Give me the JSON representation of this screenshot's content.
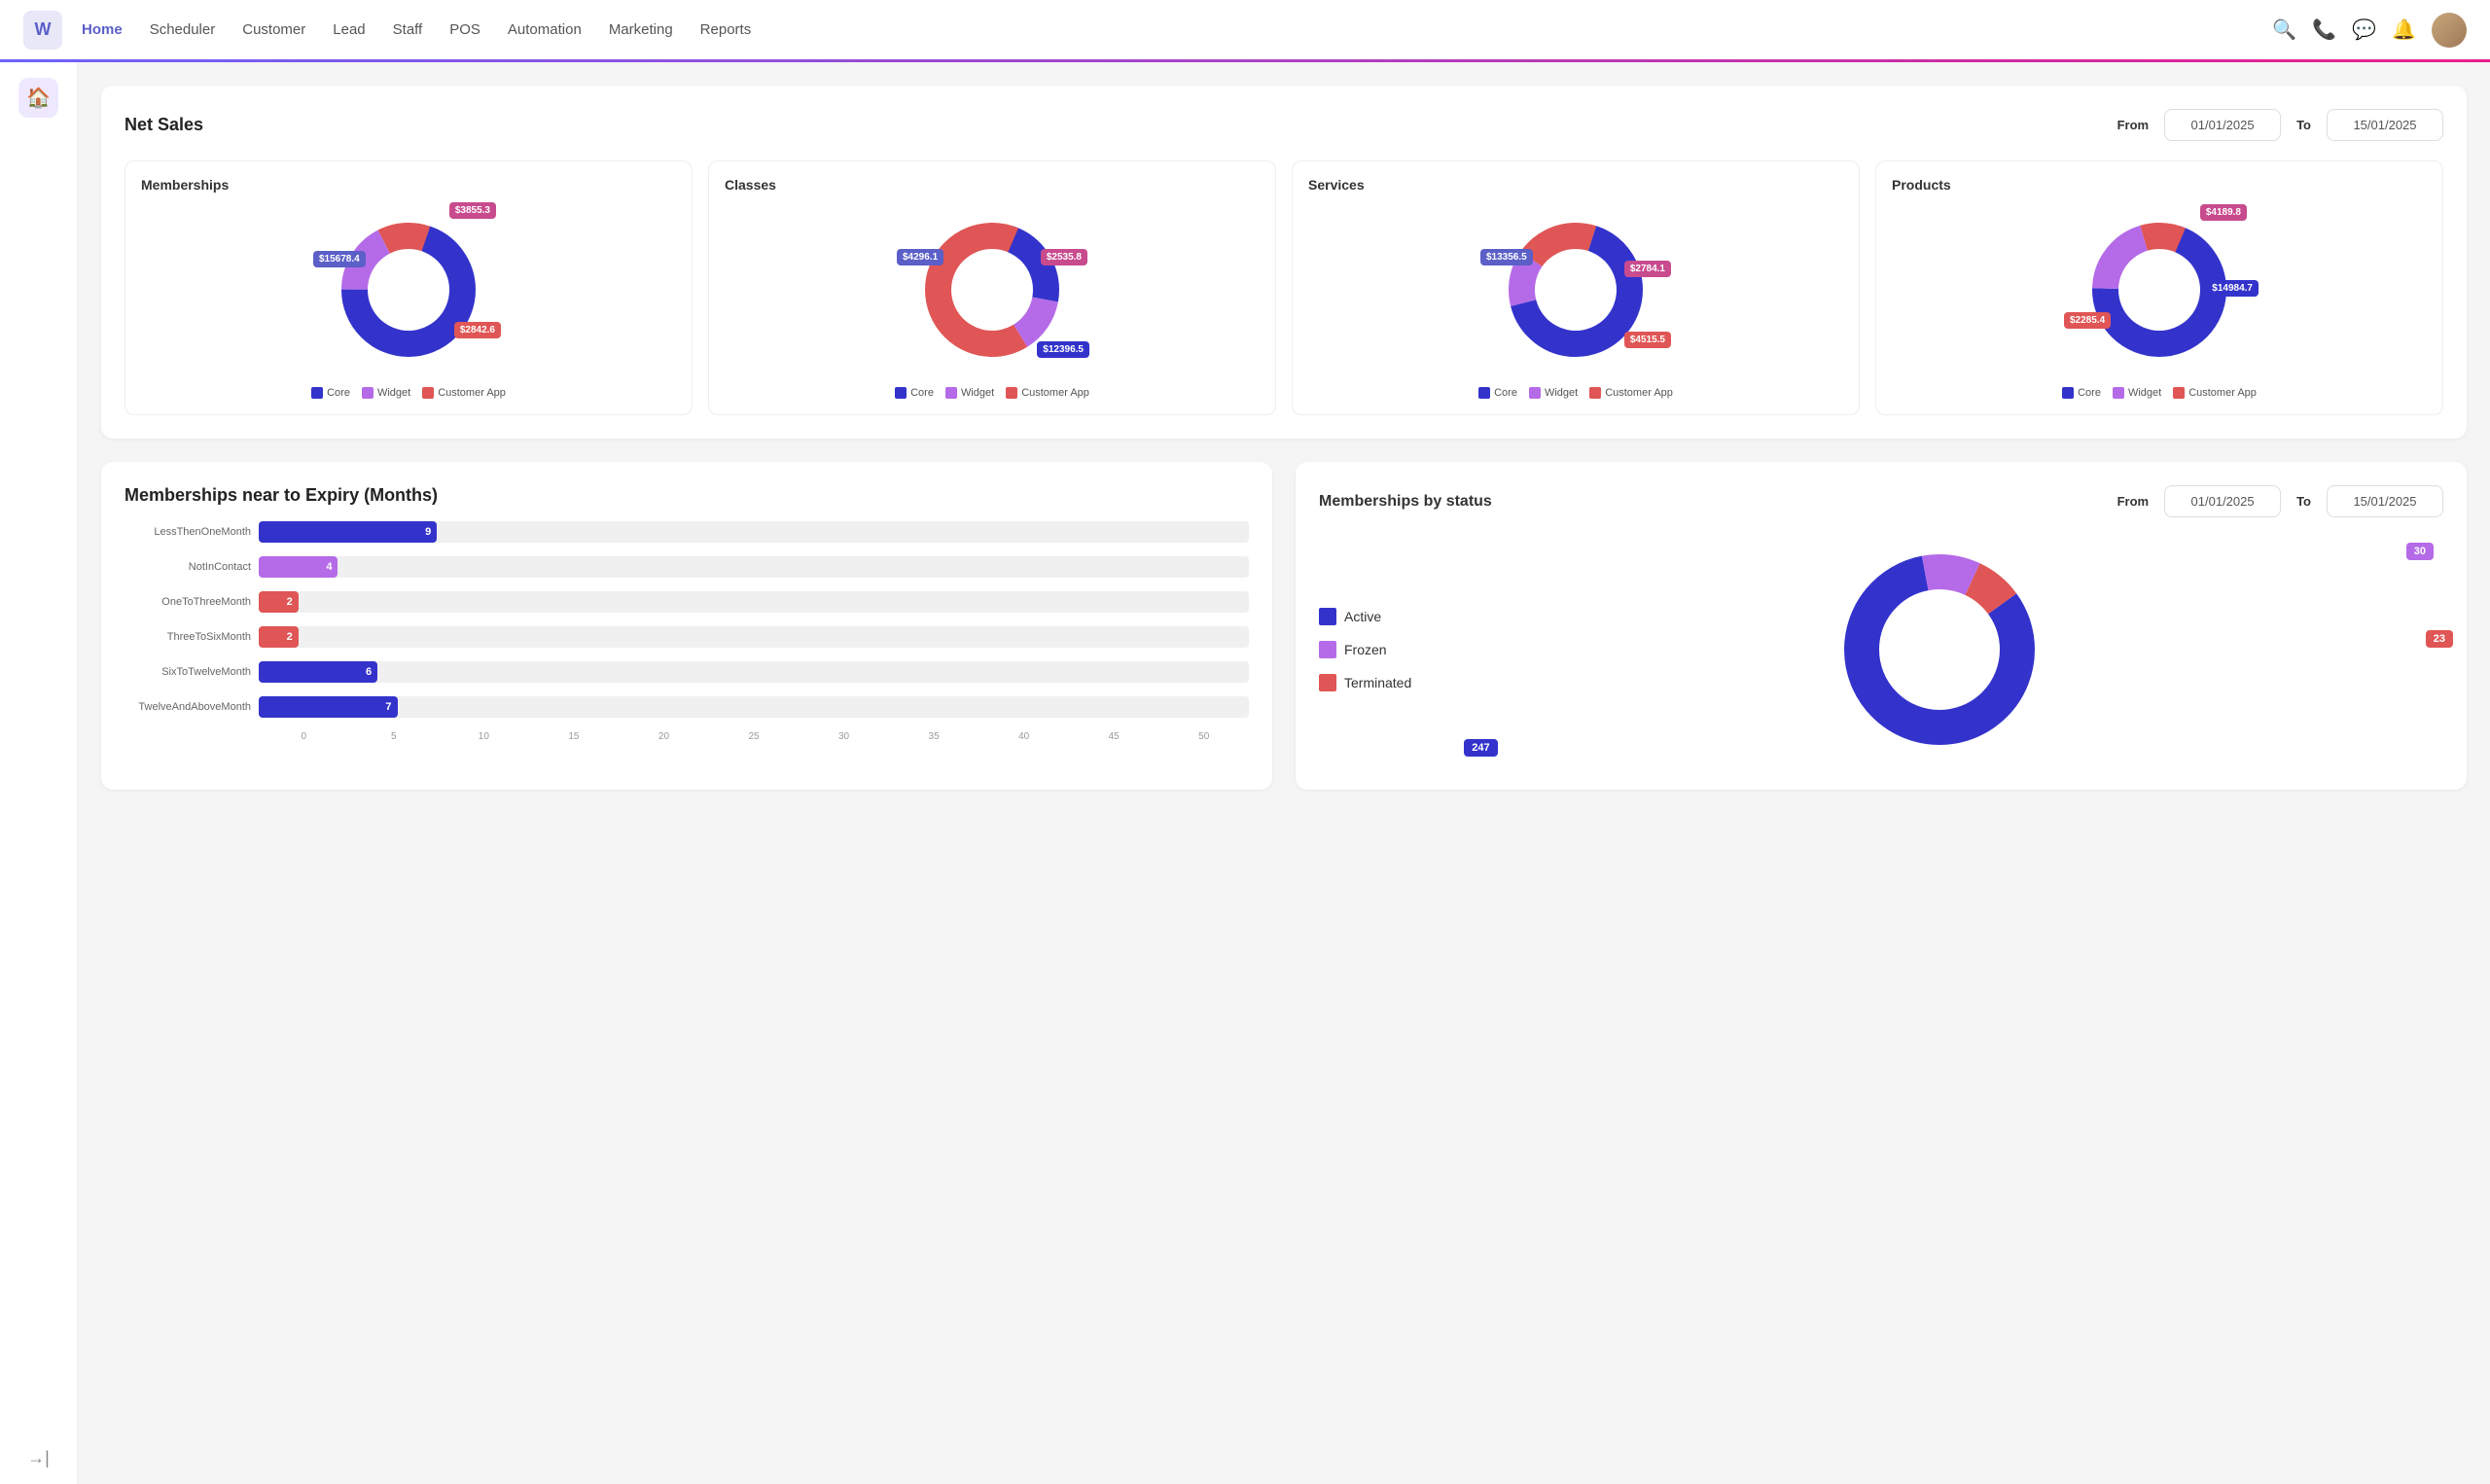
{
  "app": {
    "logo": "W",
    "nav": {
      "items": [
        {
          "label": "Home",
          "active": true
        },
        {
          "label": "Scheduler",
          "active": false
        },
        {
          "label": "Customer",
          "active": false
        },
        {
          "label": "Lead",
          "active": false
        },
        {
          "label": "Staff",
          "active": false
        },
        {
          "label": "POS",
          "active": false
        },
        {
          "label": "Automation",
          "active": false
        },
        {
          "label": "Marketing",
          "active": false
        },
        {
          "label": "Reports",
          "active": false
        }
      ]
    }
  },
  "netSales": {
    "title": "Net Sales",
    "fromLabel": "From",
    "toLabel": "To",
    "fromDate": "01/01/2025",
    "toDate": "15/01/2025",
    "charts": [
      {
        "title": "Memberships",
        "core": 15678.4,
        "widget": 3855.3,
        "customerApp": 2842.6
      },
      {
        "title": "Classes",
        "core": 4296.1,
        "widget": 2535.8,
        "customerApp": 12396.5
      },
      {
        "title": "Services",
        "core": 13356.5,
        "widget": 2784.1,
        "customerApp": 4515.5
      },
      {
        "title": "Products",
        "core": 14984.7,
        "widget": 4189.8,
        "customerApp": 2285.4
      }
    ],
    "legend": {
      "core": "Core",
      "widget": "Widget",
      "customerApp": "Customer App"
    }
  },
  "expiry": {
    "title": "Memberships near to Expiry (Months)",
    "bars": [
      {
        "label": "LessThenOneMonth",
        "value": 9,
        "max": 50,
        "color": "blue"
      },
      {
        "label": "NotInContact",
        "value": 4,
        "max": 50,
        "color": "purple"
      },
      {
        "label": "OneToThreeMonth",
        "value": 2,
        "max": 50,
        "color": "red"
      },
      {
        "label": "ThreeToSixMonth",
        "value": 2,
        "max": 50,
        "color": "red"
      },
      {
        "label": "SixToTwelveMonth",
        "value": 6,
        "max": 50,
        "color": "blue"
      },
      {
        "label": "TwelveAndAboveMonth",
        "value": 7,
        "max": 50,
        "color": "blue"
      }
    ],
    "axisTicks": [
      "0",
      "5",
      "10",
      "15",
      "20",
      "25",
      "30",
      "35",
      "40",
      "45",
      "50"
    ]
  },
  "membershipStatus": {
    "title": "Memberships by status",
    "fromLabel": "From",
    "toLabel": "To",
    "fromDate": "01/01/2025",
    "toDate": "15/01/2025",
    "legend": [
      {
        "label": "Active",
        "color": "blue"
      },
      {
        "label": "Frozen",
        "color": "purple"
      },
      {
        "label": "Terminated",
        "color": "red"
      }
    ],
    "values": {
      "active": 247,
      "frozen": 30,
      "terminated": 23
    }
  }
}
